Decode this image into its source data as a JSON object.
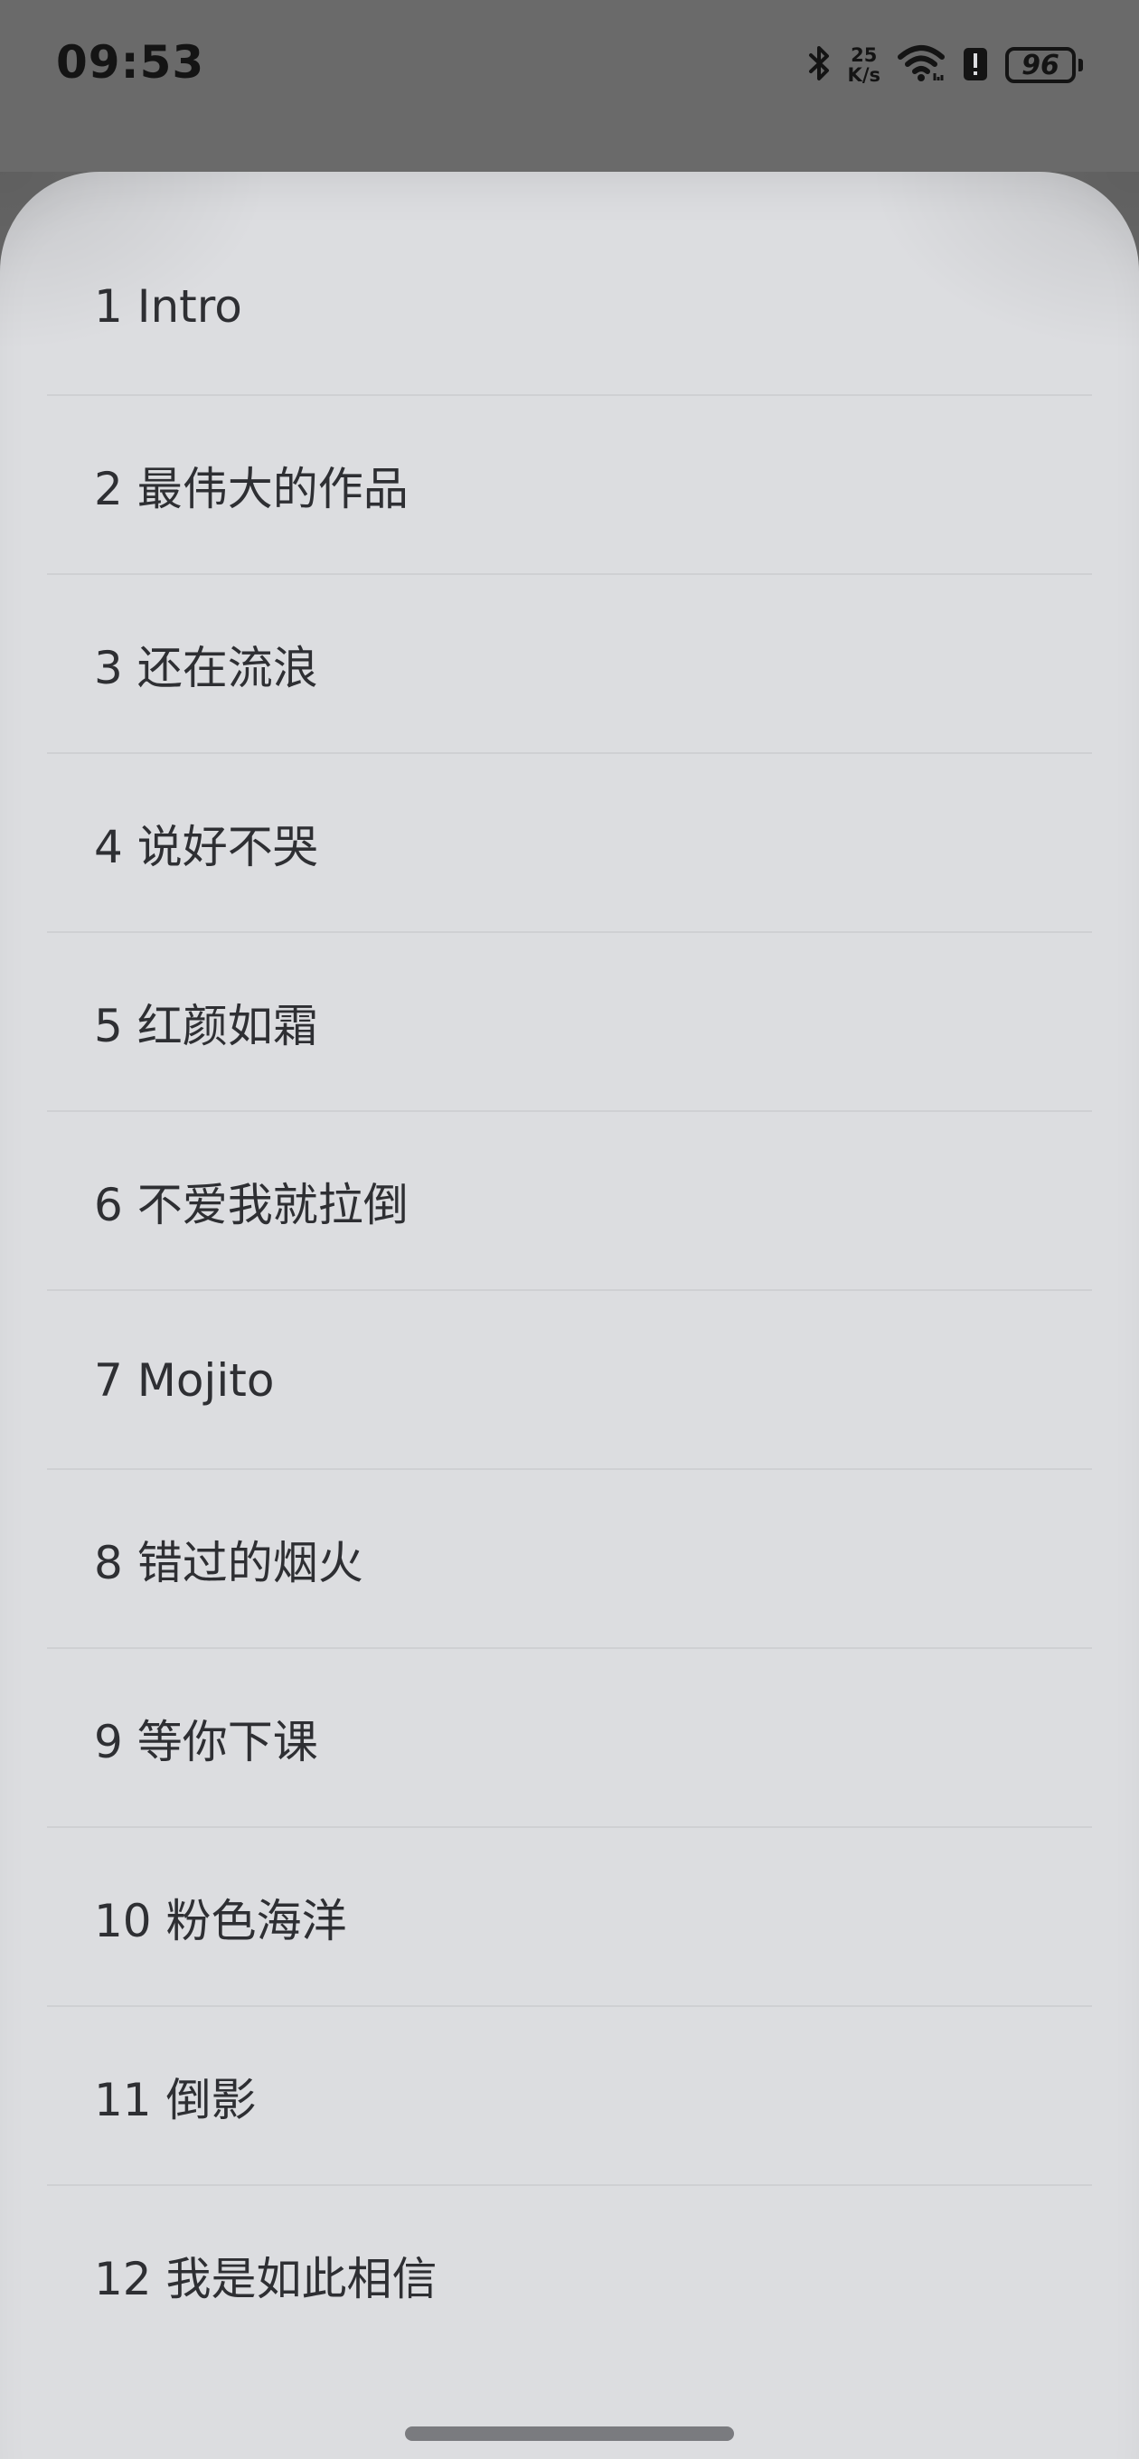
{
  "status_bar": {
    "time": "09:53",
    "net_speed_value": "25",
    "net_speed_unit": "K/s",
    "battery_level": "96",
    "icons": [
      "bluetooth-icon",
      "wifi-icon",
      "alert-icon",
      "battery-icon"
    ]
  },
  "tracks": [
    {
      "label": "1 Intro"
    },
    {
      "label": "2 最伟大的作品"
    },
    {
      "label": "3 还在流浪"
    },
    {
      "label": "4 说好不哭"
    },
    {
      "label": "5 红颜如霜"
    },
    {
      "label": "6 不爱我就拉倒"
    },
    {
      "label": "7 Mojito"
    },
    {
      "label": "8 错过的烟火"
    },
    {
      "label": "9 等你下课"
    },
    {
      "label": "10 粉色海洋"
    },
    {
      "label": "11 倒影"
    },
    {
      "label": "12 我是如此相信"
    }
  ],
  "colors": {
    "sheet_background": "#dcdde0",
    "scrim": "#6a6a6a",
    "text": "#2e2f33",
    "divider": "#cfd0d3"
  }
}
